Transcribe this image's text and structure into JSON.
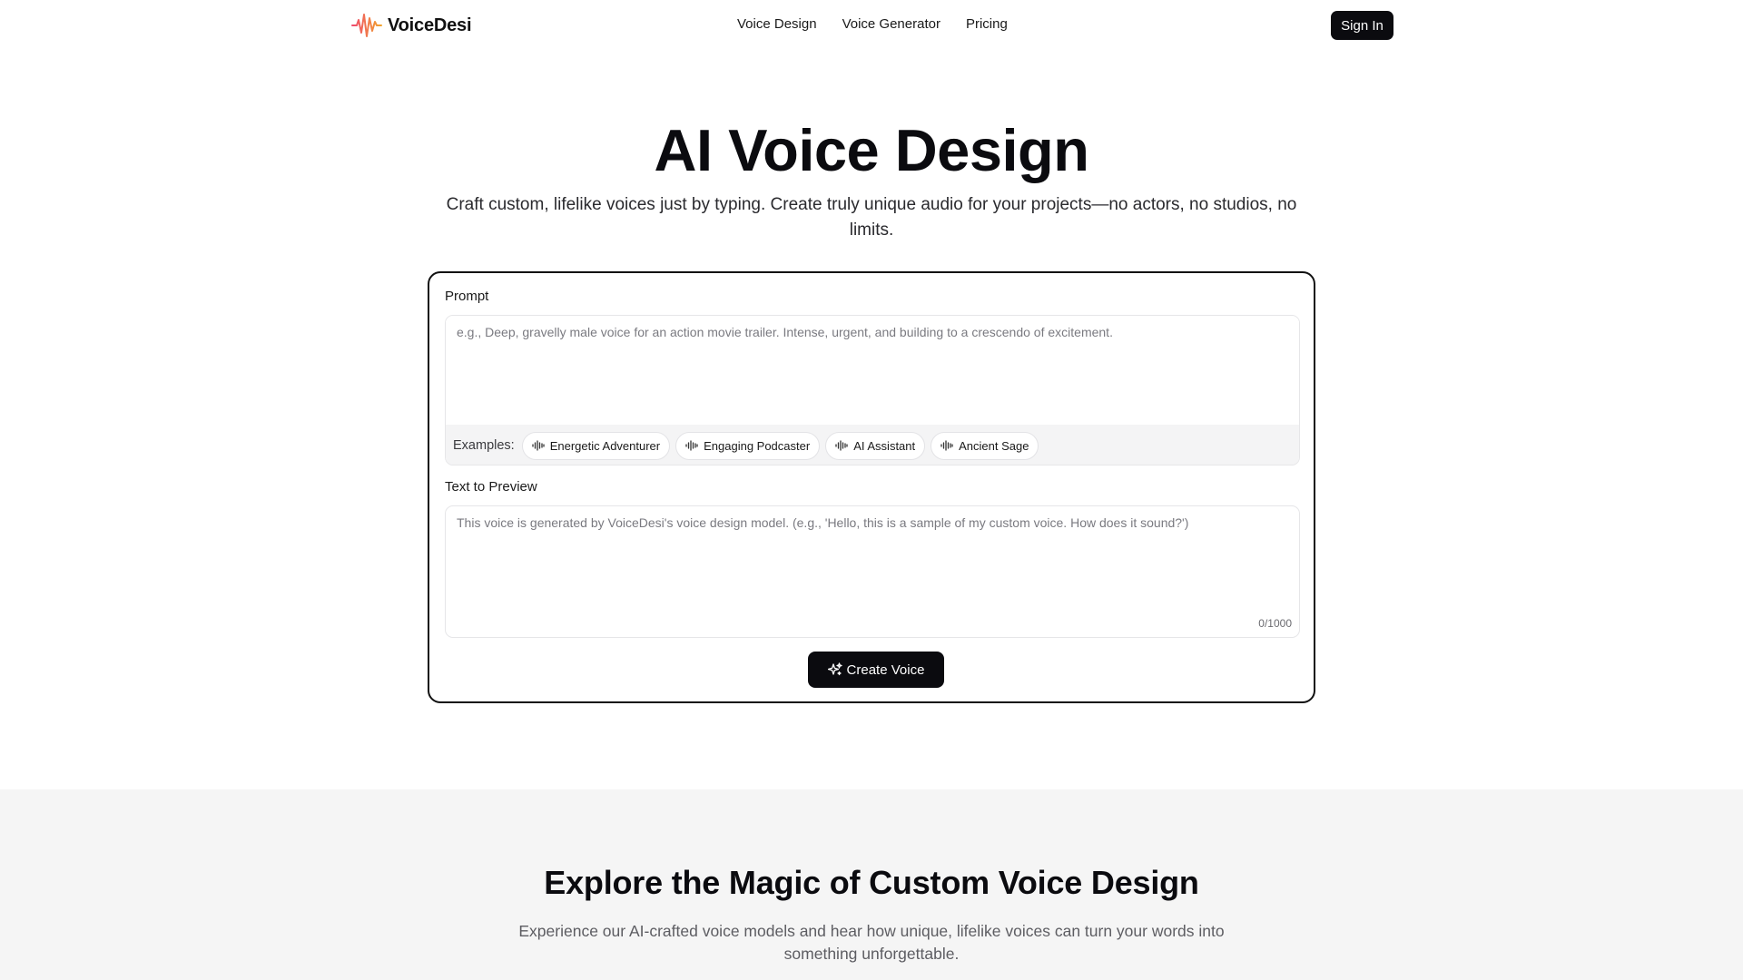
{
  "header": {
    "brand": "VoiceDesi",
    "nav": [
      "Voice Design",
      "Voice Generator",
      "Pricing"
    ],
    "sign_in": "Sign In"
  },
  "hero": {
    "title": "AI Voice Design",
    "subtitle": "Craft custom, lifelike voices just by typing. Create truly unique audio for your projects—no actors, no studios, no limits."
  },
  "form": {
    "prompt_label": "Prompt",
    "prompt_placeholder": "e.g., Deep, gravelly male voice for an action movie trailer. Intense, urgent, and building to a crescendo of excitement.",
    "examples_label": "Examples:",
    "examples": [
      "Energetic Adventurer",
      "Engaging Podcaster",
      "AI Assistant",
      "Ancient Sage"
    ],
    "preview_label": "Text to Preview",
    "preview_placeholder": "This voice is generated by VoiceDesi's voice design model. (e.g., 'Hello, this is a sample of my custom voice. How does it sound?')",
    "counter": "0/1000",
    "create_button": "Create Voice"
  },
  "explore": {
    "title": "Explore the Magic of Custom Voice Design",
    "subtitle": "Experience our AI-crafted voice models and hear how unique, lifelike voices can turn your words into something unforgettable."
  },
  "icons": {
    "logo": "waveform-logo-icon",
    "chip": "waveform-icon",
    "create": "sparkles-icon"
  },
  "colors": {
    "primary": "#0b0b0f",
    "logo_gradient_start": "#ef4a6e",
    "logo_gradient_end": "#f2a42e",
    "section_bg": "#f5f5f5"
  }
}
